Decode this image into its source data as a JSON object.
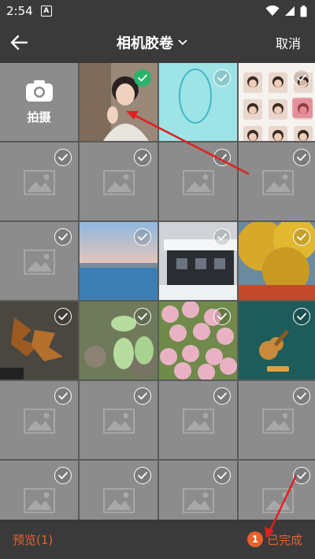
{
  "status": {
    "time": "2:54",
    "notif": "A"
  },
  "header": {
    "title": "相机胶卷",
    "cancel": "取消"
  },
  "camera": {
    "label": "拍摄"
  },
  "grid": {
    "cells": [
      {
        "kind": "camera"
      },
      {
        "kind": "photo",
        "img": "girl",
        "checked": true
      },
      {
        "kind": "photo",
        "img": "cyan",
        "checked": false
      },
      {
        "kind": "photo",
        "img": "faces",
        "checked": false
      },
      {
        "kind": "ph",
        "checked": false
      },
      {
        "kind": "ph",
        "checked": false
      },
      {
        "kind": "ph",
        "checked": false
      },
      {
        "kind": "ph",
        "checked": false
      },
      {
        "kind": "ph",
        "checked": false
      },
      {
        "kind": "photo",
        "img": "sea",
        "checked": false
      },
      {
        "kind": "photo",
        "img": "snow",
        "checked": false
      },
      {
        "kind": "photo",
        "img": "ginkgo",
        "checked": false
      },
      {
        "kind": "photo",
        "img": "leaves",
        "checked": false
      },
      {
        "kind": "photo",
        "img": "frogs",
        "checked": false
      },
      {
        "kind": "photo",
        "img": "blossom",
        "checked": false
      },
      {
        "kind": "photo",
        "img": "ukulele",
        "checked": false
      },
      {
        "kind": "ph",
        "checked": false
      },
      {
        "kind": "ph",
        "checked": false
      },
      {
        "kind": "ph",
        "checked": false
      },
      {
        "kind": "ph",
        "checked": false
      },
      {
        "kind": "ph",
        "checked": false
      },
      {
        "kind": "ph",
        "checked": false
      },
      {
        "kind": "ph",
        "checked": false
      },
      {
        "kind": "ph",
        "checked": false
      }
    ]
  },
  "footer": {
    "preview": "预览(1)",
    "count": "1",
    "done": "已完成"
  },
  "colors": {
    "accent": "#e8612c",
    "check": "#29b36b",
    "annotation": "#e02020"
  }
}
